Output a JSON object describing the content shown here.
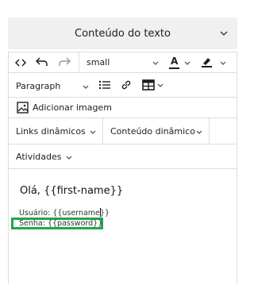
{
  "panel": {
    "title": "Conteúdo do texto"
  },
  "toolbar": {
    "font_size": "small",
    "block_type": "Paragraph",
    "add_image": "Adicionar imagem",
    "dynamic_links": "Links dinâmicos",
    "dynamic_content": "Conteúdo dinâmico",
    "activities": "Atividades"
  },
  "content": {
    "greeting": "Olá, {{first-name}}",
    "username_line": "Usuário: {{username}}",
    "password_line": "Senha: {{password}}"
  },
  "colors": {
    "highlight": "#20a84a",
    "panel_bg": "#f0f0f0",
    "border": "#dddddd"
  }
}
